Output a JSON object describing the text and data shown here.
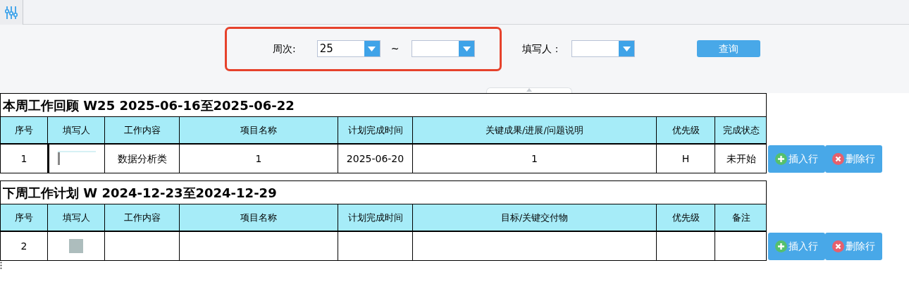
{
  "filters": {
    "week_label": "周次:",
    "week_from": "25",
    "range_sep": "~",
    "filler_label": "填写人：",
    "query_button": "查询"
  },
  "sections": [
    {
      "title": "本周工作回顾 W25 2025-06-16至2025-06-22",
      "columns": [
        "序号",
        "填写人",
        "工作内容",
        "项目名称",
        "计划完成时间",
        "关键成果/进展/问题说明",
        "优先级",
        "完成状态"
      ],
      "rows": [
        {
          "cells": [
            "1",
            {
              "kind": "text-input"
            },
            "数据分析类",
            "1",
            "2025-06-20",
            "1",
            "H",
            "未开始"
          ],
          "actions": [
            {
              "kind": "insert",
              "label": "插入行"
            },
            {
              "kind": "delete",
              "label": "删除行"
            }
          ]
        }
      ]
    },
    {
      "title": "下周工作计划 W 2024-12-23至2024-12-29",
      "columns": [
        "序号",
        "填写人",
        "工作内容",
        "项目名称",
        "计划完成时间",
        "目标/关键交付物",
        "优先级",
        "备注"
      ],
      "rows": [
        {
          "cells": [
            "2",
            {
              "kind": "swatch"
            }
          ],
          "actions": [
            {
              "kind": "insert",
              "label": "插入行"
            },
            {
              "kind": "delete",
              "label": "删除行"
            }
          ]
        }
      ]
    }
  ]
}
